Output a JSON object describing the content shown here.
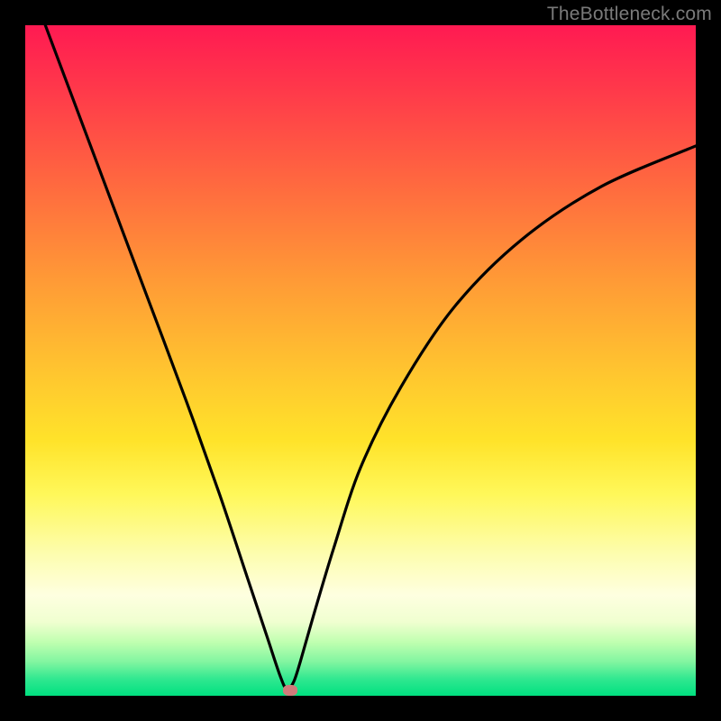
{
  "watermark_text": "TheBottleneck.com",
  "chart_data": {
    "type": "line",
    "title": "",
    "xlabel": "",
    "ylabel": "",
    "xlim": [
      0,
      100
    ],
    "ylim": [
      0,
      100
    ],
    "series": [
      {
        "name": "bottleneck-curve",
        "x": [
          0,
          6,
          12,
          18,
          24,
          29,
          33,
          36,
          38,
          39,
          40,
          41,
          43,
          46,
          50,
          56,
          64,
          74,
          86,
          100
        ],
        "y": [
          108,
          92,
          76,
          60,
          44,
          30,
          18,
          9,
          3,
          1,
          2,
          5,
          12,
          22,
          34,
          46,
          58,
          68,
          76,
          82
        ]
      }
    ],
    "marker": {
      "x": 39.5,
      "y": 0.8,
      "color": "#cf7b7b"
    },
    "background_gradient": {
      "stops": [
        {
          "pct": 0,
          "color": "#ff1a52"
        },
        {
          "pct": 50,
          "color": "#ffc030"
        },
        {
          "pct": 75,
          "color": "#fff85a"
        },
        {
          "pct": 92,
          "color": "#c0ffb0"
        },
        {
          "pct": 100,
          "color": "#00e080"
        }
      ]
    }
  }
}
